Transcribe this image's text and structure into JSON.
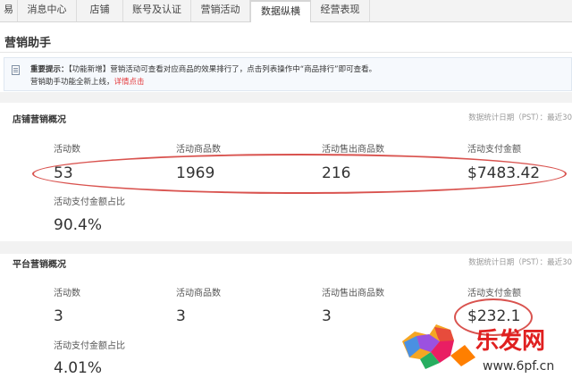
{
  "tabs": [
    {
      "label": "易",
      "active": false
    },
    {
      "label": "消息中心",
      "active": false
    },
    {
      "label": "店铺",
      "active": false
    },
    {
      "label": "账号及认证",
      "active": false
    },
    {
      "label": "营销活动",
      "active": false
    },
    {
      "label": "数据纵横",
      "active": true
    },
    {
      "label": "经营表现",
      "active": false
    }
  ],
  "page_title": "营销助手",
  "notice": {
    "icon": "document-icon",
    "prefix": "重要提示：",
    "line1": "【功能新增】营销活动可查看对应商品的效果排行了，点击列表操作中“商品排行”即可查看。",
    "line2": "营销助手功能全新上线，",
    "link": "详情点击"
  },
  "store_section": {
    "title": "店铺营销概况",
    "date_text": "数据统计日期（PST）：最近30",
    "metrics": [
      {
        "label": "活动数",
        "value": "53"
      },
      {
        "label": "活动商品数",
        "value": "1969"
      },
      {
        "label": "活动售出商品数",
        "value": "216"
      },
      {
        "label": "活动支付金额",
        "value": "$7483.42"
      }
    ],
    "ratio": {
      "label": "活动支付金额占比",
      "value": "90.4%"
    }
  },
  "platform_section": {
    "title": "平台营销概况",
    "date_text": "数据统计日期（PST）：最近30",
    "metrics": [
      {
        "label": "活动数",
        "value": "3"
      },
      {
        "label": "活动商品数",
        "value": "3"
      },
      {
        "label": "活动售出商品数",
        "value": "3"
      },
      {
        "label": "活动支付金额",
        "value": "$232.1"
      }
    ],
    "ratio": {
      "label": "活动支付金额占比",
      "value": "4.01%"
    }
  },
  "watermark": {
    "brand": "乐发网",
    "url": "www.6pf.cn"
  },
  "colors": {
    "annotation": "#d9534f",
    "link": "#e4393c",
    "tab_bar": "#f3f3f3",
    "notice_bg": "#f6f9fd"
  }
}
